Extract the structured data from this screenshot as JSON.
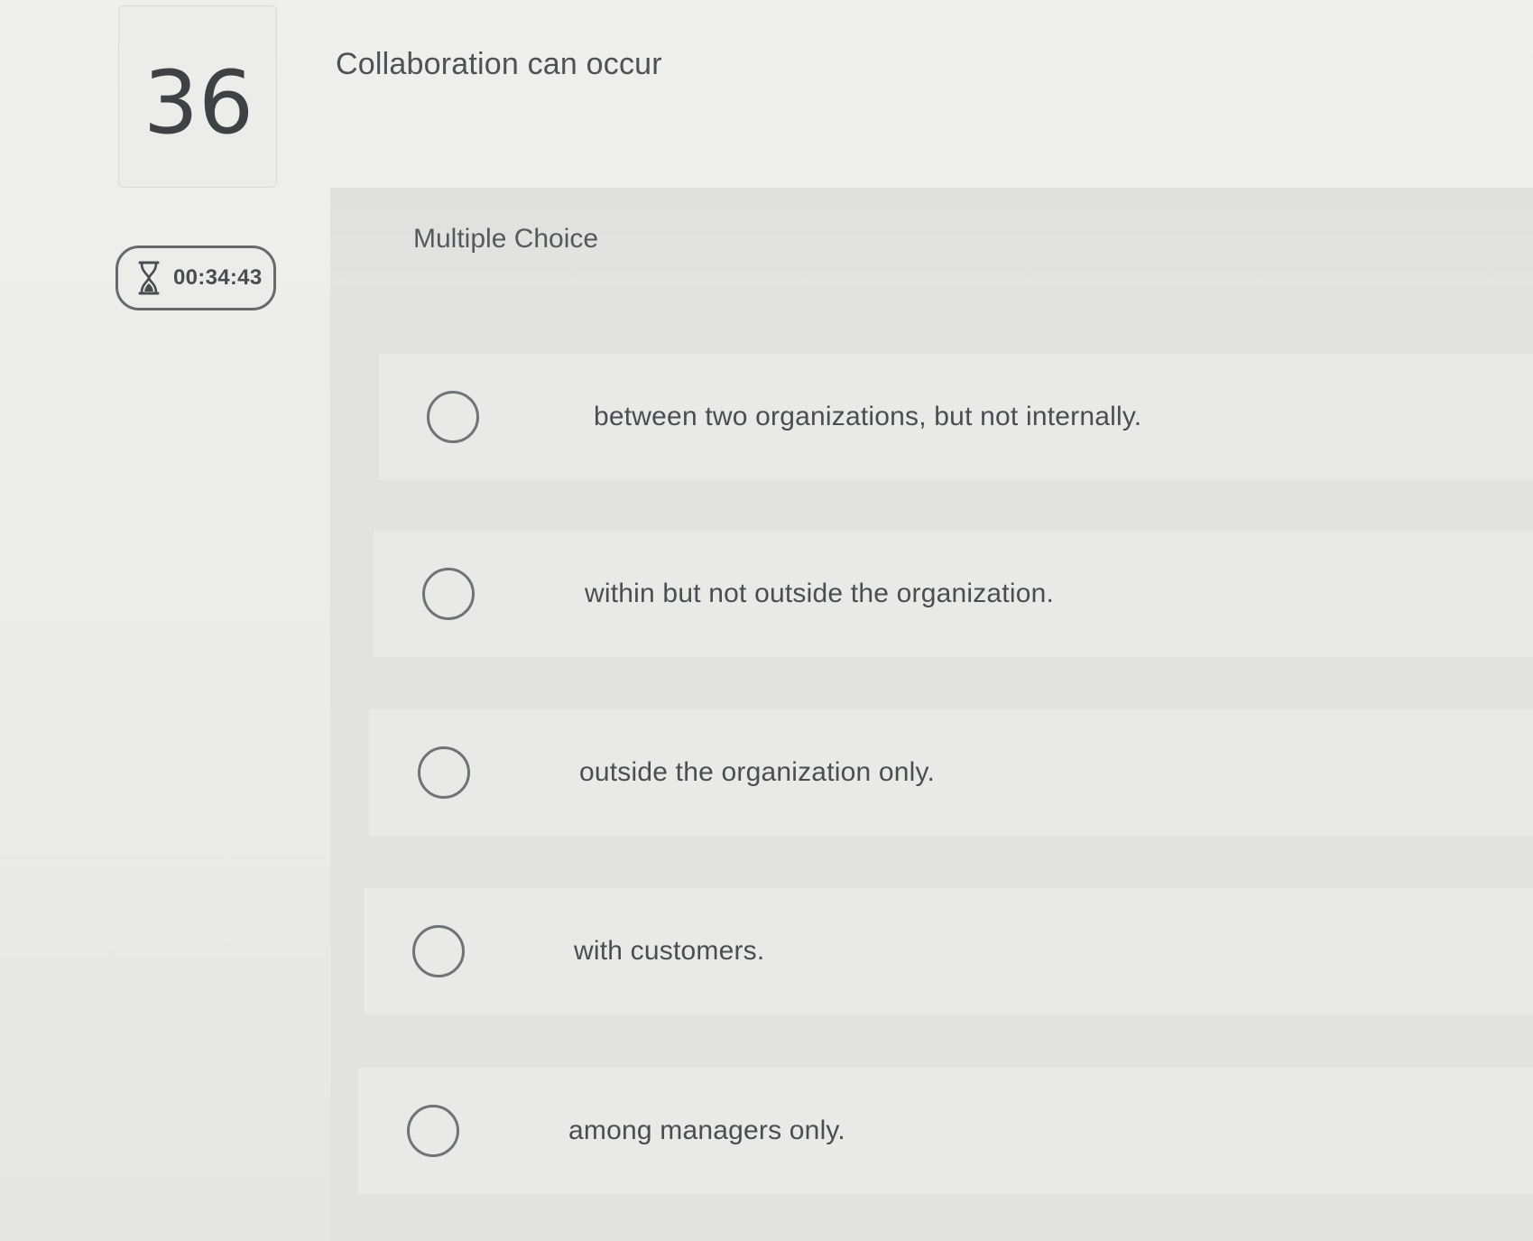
{
  "question": {
    "number": "36",
    "prompt": "Collaboration can occur",
    "type_label": "Multiple Choice"
  },
  "timer": {
    "icon": "hourglass-icon",
    "value": "00:34:43"
  },
  "options": [
    {
      "label": "between two organizations, but not internally.",
      "selected": false
    },
    {
      "label": "within but not outside the organization.",
      "selected": false
    },
    {
      "label": "outside the organization only.",
      "selected": false
    },
    {
      "label": "with customers.",
      "selected": false
    },
    {
      "label": "among managers only.",
      "selected": false
    }
  ],
  "colors": {
    "background": "#ececea",
    "panel": "#e2e2e0",
    "text": "#4b4e51",
    "radio_border": "#707375"
  }
}
